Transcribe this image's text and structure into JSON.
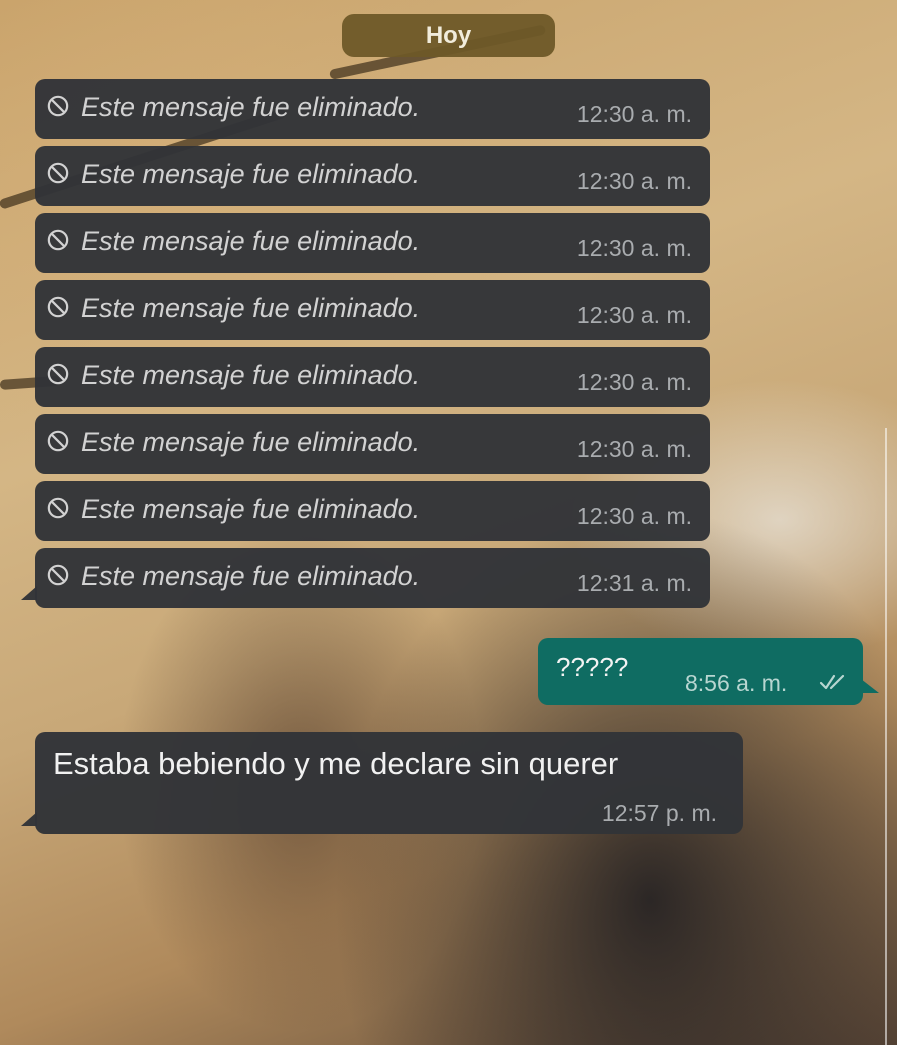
{
  "date_chip": {
    "label": "Hoy"
  },
  "deleted_messages": [
    {
      "text": "Este mensaje fue eliminado.",
      "time": "12:30 a. m."
    },
    {
      "text": "Este mensaje fue eliminado.",
      "time": "12:30 a. m."
    },
    {
      "text": "Este mensaje fue eliminado.",
      "time": "12:30 a. m."
    },
    {
      "text": "Este mensaje fue eliminado.",
      "time": "12:30 a. m."
    },
    {
      "text": "Este mensaje fue eliminado.",
      "time": "12:30 a. m."
    },
    {
      "text": "Este mensaje fue eliminado.",
      "time": "12:30 a. m."
    },
    {
      "text": "Este mensaje fue eliminado.",
      "time": "12:30 a. m."
    },
    {
      "text": "Este mensaje fue eliminado.",
      "time": "12:31 a. m."
    }
  ],
  "outgoing_message": {
    "text": "?????",
    "time": "8:56 a. m.",
    "status_icon": "double-check-icon"
  },
  "incoming_message": {
    "text": "Estaba bebiendo y me declare sin querer",
    "time": "12:57 p. m."
  },
  "deleted_icon": "ban-icon",
  "colors": {
    "incoming_bubble": "#323438",
    "outgoing_bubble": "#0f6c62",
    "date_chip": "#6e5828"
  }
}
